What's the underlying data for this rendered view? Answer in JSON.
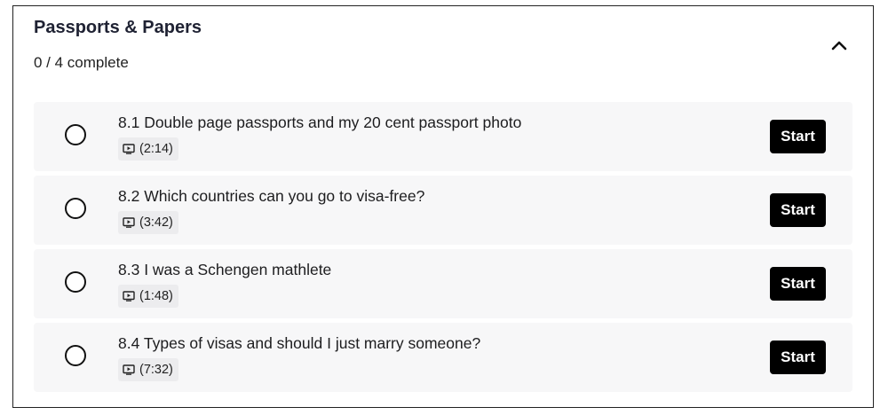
{
  "section": {
    "title": "Passports & Papers",
    "progress": "0 / 4 complete"
  },
  "icons": {
    "collapse": "chevron-up-icon",
    "duration": "video-play-icon",
    "status": "empty-circle-icon"
  },
  "lessons": [
    {
      "title": "8.1 Double page passports and my 20 cent passport photo",
      "duration": "(2:14)",
      "action": "Start"
    },
    {
      "title": "8.2 Which countries can you go to visa-free?",
      "duration": "(3:42)",
      "action": "Start"
    },
    {
      "title": "8.3 I was a Schengen mathlete",
      "duration": "(1:48)",
      "action": "Start"
    },
    {
      "title": "8.4 Types of visas and should I just marry someone?",
      "duration": "(7:32)",
      "action": "Start"
    }
  ]
}
